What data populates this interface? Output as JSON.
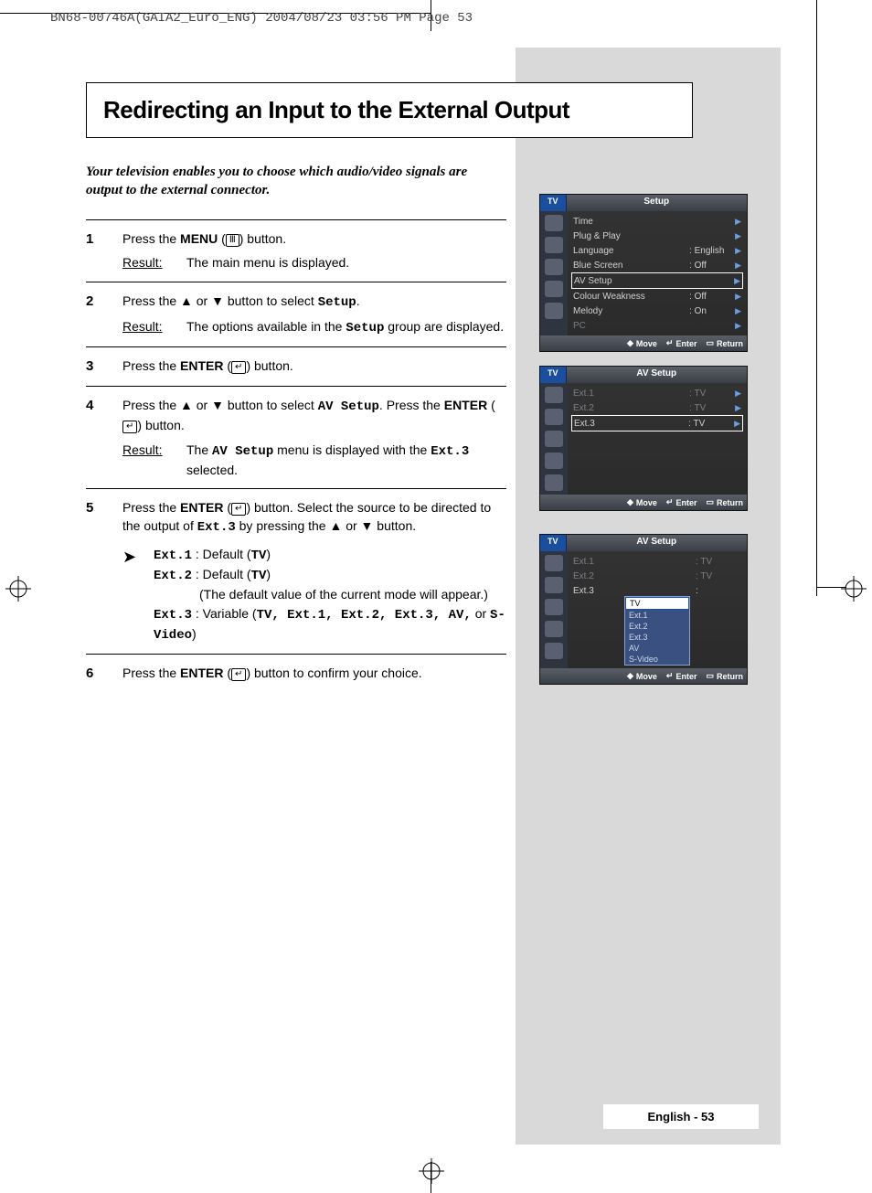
{
  "header_line": "BN68-00746A(GAIA2_Euro_ENG)  2004/08/23  03:56 PM  Page 53",
  "title": "Redirecting an Input to the External Output",
  "intro": "Your television enables you to choose which audio/video signals are output to the external connector.",
  "steps": [
    {
      "num": "1",
      "text_parts": [
        "Press the ",
        "MENU",
        " (",
        "icon",
        ") button."
      ],
      "result": "The main menu is displayed."
    },
    {
      "num": "2",
      "text_parts": [
        "Press the ▲ or ▼ button to select ",
        "Setup",
        "."
      ],
      "result_parts": [
        "The options available in the ",
        "Setup",
        " group are displayed."
      ]
    },
    {
      "num": "3",
      "text_parts": [
        "Press the ",
        "ENTER",
        " (",
        "icon",
        ") button."
      ]
    },
    {
      "num": "4",
      "text_parts": [
        "Press the ▲ or ▼ button to select ",
        "AV Setup",
        ". Press the ",
        "ENTER",
        " (",
        "icon",
        ") button."
      ],
      "result_parts": [
        "The ",
        "AV Setup",
        " menu is displayed with the ",
        "Ext.3",
        " selected."
      ]
    },
    {
      "num": "5",
      "text_parts": [
        "Press the ",
        "ENTER",
        " (",
        "icon",
        ") button. Select the source to be directed to the output of ",
        "Ext.3",
        " by pressing the ▲ or ▼ button."
      ],
      "bullets": [
        {
          "k": "Ext.1",
          "v": " : Default (",
          "b": "TV",
          "after": ")"
        },
        {
          "k": "Ext.2",
          "v": " : Default (",
          "b": "TV",
          "after": ")"
        },
        {
          "note": "(The default value of the current mode will appear.)"
        },
        {
          "k": "Ext.3",
          "v": " : Variable (",
          "list": "TV, Ext.1, Ext.2, Ext.3, AV,",
          "or": " or ",
          "last": "S-Video",
          "after": ")"
        }
      ]
    },
    {
      "num": "6",
      "text_parts": [
        "Press the ",
        "ENTER",
        " (",
        "icon",
        ") button to confirm your choice."
      ]
    }
  ],
  "menu1": {
    "tab": "TV",
    "title": "Setup",
    "rows": [
      {
        "lbl": "Time",
        "val": "",
        "arr": true
      },
      {
        "lbl": "Plug & Play",
        "val": "",
        "arr": true
      },
      {
        "lbl": "Language",
        "val": ": English",
        "arr": true
      },
      {
        "lbl": "Blue Screen",
        "val": ": Off",
        "arr": true
      },
      {
        "lbl": "AV Setup",
        "val": "",
        "arr": true,
        "sel": true
      },
      {
        "lbl": "Colour Weakness",
        "val": ": Off",
        "arr": true
      },
      {
        "lbl": "Melody",
        "val": ": On",
        "arr": true
      },
      {
        "lbl": "PC",
        "val": "",
        "arr": true,
        "dim": true
      }
    ],
    "foot": {
      "move": "Move",
      "enter": "Enter",
      "ret": "Return"
    }
  },
  "menu2": {
    "tab": "TV",
    "title": "AV Setup",
    "rows": [
      {
        "lbl": "Ext.1",
        "val": ": TV",
        "arr": true,
        "dim": true
      },
      {
        "lbl": "Ext.2",
        "val": ": TV",
        "arr": true,
        "dim": true
      },
      {
        "lbl": "Ext.3",
        "val": ": TV",
        "arr": true,
        "sel": true
      }
    ],
    "foot": {
      "move": "Move",
      "enter": "Enter",
      "ret": "Return"
    }
  },
  "menu3": {
    "tab": "TV",
    "title": "AV Setup",
    "rows": [
      {
        "lbl": "Ext.1",
        "val": ": TV",
        "dim": true
      },
      {
        "lbl": "Ext.2",
        "val": ": TV",
        "dim": true
      },
      {
        "lbl": "Ext.3",
        "val": ":"
      }
    ],
    "dropdown": [
      "TV",
      "Ext.1",
      "Ext.2",
      "Ext.3",
      "AV",
      "S-Video"
    ],
    "dropdown_sel": "TV",
    "foot": {
      "move": "Move",
      "enter": "Enter",
      "ret": "Return"
    }
  },
  "footer": "English - 53"
}
